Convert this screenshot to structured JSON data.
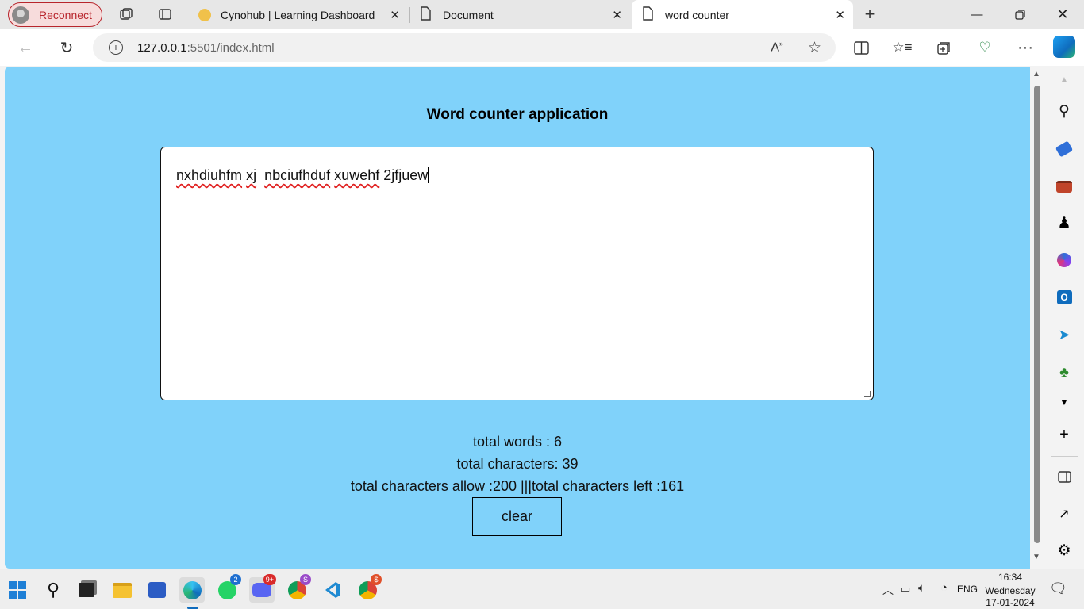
{
  "browser": {
    "profile_button": "Reconnect",
    "tabs": [
      {
        "title": "Cynohub | Learning Dashboard"
      },
      {
        "title": "Document"
      },
      {
        "title": "word counter"
      }
    ],
    "address": {
      "host": "127.0.0.1",
      "rest": ":5501/index.html"
    }
  },
  "page": {
    "title": "Word counter application",
    "textarea": {
      "words": [
        "nxhdiuhfm",
        "xj",
        "nbciufhduf",
        "xuwehf",
        "2jfjuew"
      ],
      "value": "nxhdiuhfm xj  nbciufhduf xuwehf 2jfjuew"
    },
    "stats": {
      "total_words": "total words : 6",
      "total_characters": "total characters: 39",
      "allowance": "total characters allow :200 |||total characters left :161"
    },
    "clear_label": "clear"
  },
  "taskbar": {
    "whatsapp_badge": "2",
    "discord_badge": "9+",
    "chrome_badge": "S",
    "chrome2_badge": "$",
    "language": "ENG",
    "time": "16:34",
    "day": "Wednesday",
    "date": "17-01-2024"
  },
  "colors": {
    "page_bg": "#80d2fa",
    "edge_accent": "#0f6cbd",
    "reconnect_red": "#b8252c"
  }
}
